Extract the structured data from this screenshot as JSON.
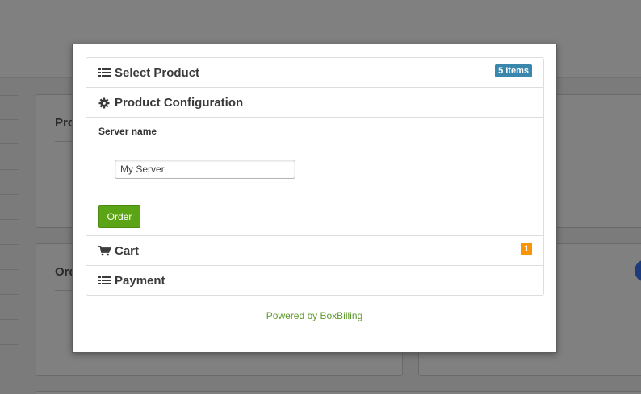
{
  "background": {
    "panel_top_left_title": "Pro",
    "panel_bottom_left_title": "Ord"
  },
  "modal": {
    "sections": {
      "select_product": {
        "label": "Select Product",
        "badge": "5 Items",
        "icon": "list-icon"
      },
      "product_configuration": {
        "label": "Product Configuration",
        "icon": "gear-icon",
        "field_label": "Server name",
        "server_name_value": "My Server",
        "order_label": "Order"
      },
      "cart": {
        "label": "Cart",
        "badge": "1",
        "icon": "cart-icon"
      },
      "payment": {
        "label": "Payment",
        "icon": "list-icon"
      }
    },
    "powered_by": "Powered by BoxBilling"
  },
  "colors": {
    "badge_blue": "#3a87ad",
    "badge_orange": "#f89406",
    "order_button": "#5aa415",
    "powered_text": "#5f9a2c"
  }
}
